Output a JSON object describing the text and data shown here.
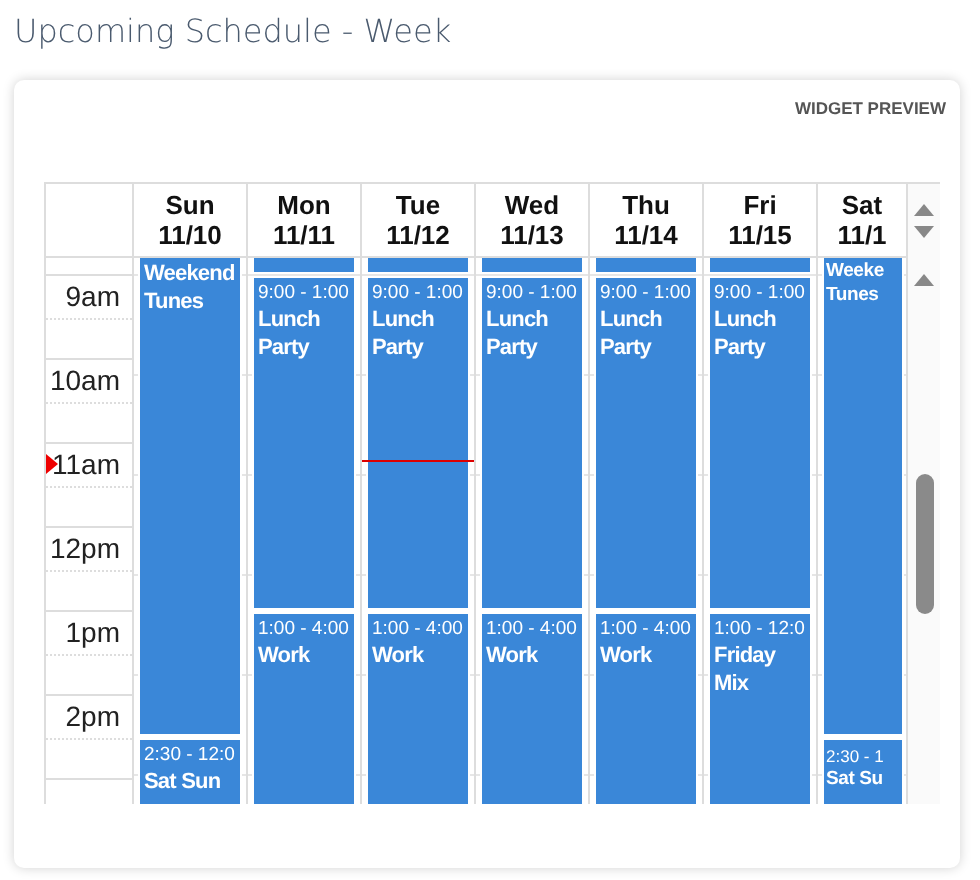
{
  "title": "Upcoming Schedule - Week",
  "preview_label": "WIDGET PREVIEW",
  "hours": [
    "9am",
    "10am",
    "11am",
    "12pm",
    "1pm",
    "2pm"
  ],
  "days": [
    {
      "name": "Sun",
      "date": "11/10",
      "now": false,
      "events": [
        {
          "title": "Weekend Tunes"
        },
        {
          "time": "2:30 - 12:0",
          "title": "Sat Sun"
        }
      ]
    },
    {
      "name": "Mon",
      "date": "11/11",
      "now": false,
      "events": [
        {
          "time": "9:00 - 1:00",
          "title": "Lunch Party"
        },
        {
          "time": "1:00 - 4:00",
          "title": "Work"
        }
      ]
    },
    {
      "name": "Tue",
      "date": "11/12",
      "now": true,
      "events": [
        {
          "time": "9:00 - 1:00",
          "title": "Lunch Party"
        },
        {
          "time": "1:00 - 4:00",
          "title": "Work"
        }
      ]
    },
    {
      "name": "Wed",
      "date": "11/13",
      "now": false,
      "events": [
        {
          "time": "9:00 - 1:00",
          "title": "Lunch Party"
        },
        {
          "time": "1:00 - 4:00",
          "title": "Work"
        }
      ]
    },
    {
      "name": "Thu",
      "date": "11/14",
      "now": false,
      "events": [
        {
          "time": "9:00 - 1:00",
          "title": "Lunch Party"
        },
        {
          "time": "1:00 - 4:00",
          "title": "Work"
        }
      ]
    },
    {
      "name": "Fri",
      "date": "11/15",
      "now": false,
      "events": [
        {
          "time": "9:00 - 1:00",
          "title": "Lunch Party"
        },
        {
          "time": "1:00 - 12:0",
          "title": "Friday Mix"
        }
      ]
    },
    {
      "name": "Sat",
      "date": "11/1",
      "now": false,
      "events": [
        {
          "title": "Weeke Tunes"
        },
        {
          "time": "2:30 - 1",
          "title": "Sat Su"
        }
      ]
    }
  ]
}
